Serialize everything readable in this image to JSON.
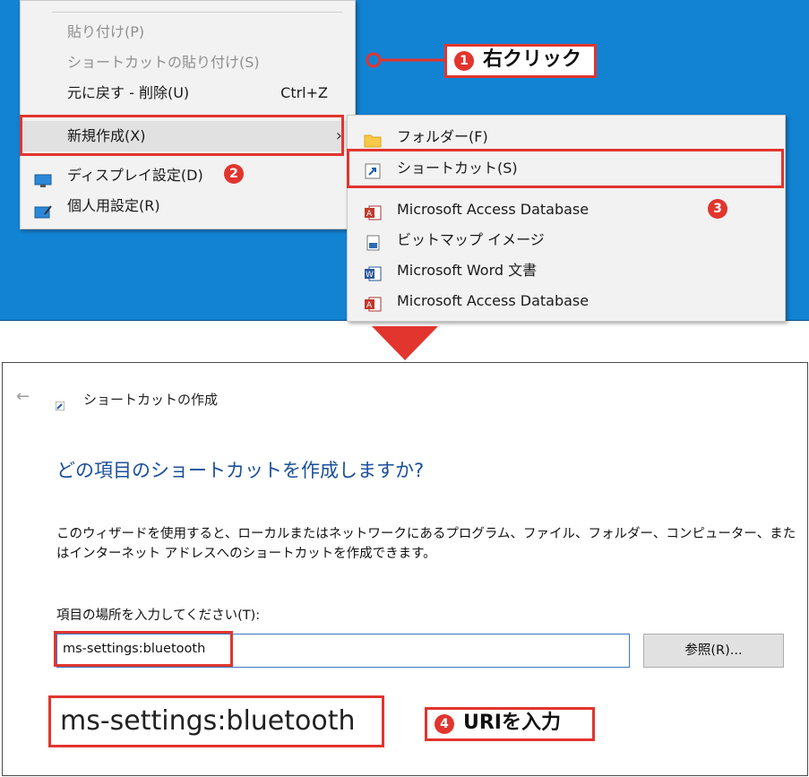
{
  "context_menu": {
    "items": [
      {
        "label": "貼り付け(P)",
        "accel": "",
        "disabled": true
      },
      {
        "label": "ショートカットの貼り付け(S)",
        "accel": "",
        "disabled": true
      },
      {
        "label": "元に戻す - 削除(U)",
        "accel": "Ctrl+Z",
        "disabled": false
      },
      {
        "label": "新規作成(X)",
        "accel": "",
        "disabled": false
      },
      {
        "label": "ディスプレイ設定(D)",
        "accel": "",
        "disabled": false
      },
      {
        "label": "個人用設定(R)",
        "accel": "",
        "disabled": false
      }
    ]
  },
  "submenu": {
    "items": [
      {
        "label": "フォルダー(F)",
        "icon": "folder-icon"
      },
      {
        "label": "ショートカット(S)",
        "icon": "shortcut-icon"
      },
      {
        "label": "Microsoft Access Database",
        "icon": "access-icon"
      },
      {
        "label": "ビットマップ イメージ",
        "icon": "bitmap-icon"
      },
      {
        "label": "Microsoft Word 文書",
        "icon": "word-icon"
      },
      {
        "label": "Microsoft Access Database",
        "icon": "access-icon"
      }
    ]
  },
  "annotations": {
    "step1": {
      "number": "1",
      "text": "右クリック"
    },
    "step2": {
      "number": "2"
    },
    "step3": {
      "number": "3"
    },
    "step4": {
      "number": "4",
      "text": "URIを入力"
    }
  },
  "dialog": {
    "title": "ショートカットの作成",
    "heading": "どの項目のショートカットを作成しますか?",
    "description": "このウィザードを使用すると、ローカルまたはネットワークにあるプログラム、ファイル、フォルダー、コンピューター、またはインターネット アドレスへのショートカットを作成できます。",
    "location_label": "項目の場所を入力してください(T):",
    "location_value": "ms-settings:bluetooth",
    "browse_label": "参照(R)...",
    "zoom_text": "ms-settings:bluetooth"
  },
  "colors": {
    "accent_red": "#e1352e",
    "desktop_blue": "#1283d3",
    "heading_blue": "#1a4f9c"
  }
}
